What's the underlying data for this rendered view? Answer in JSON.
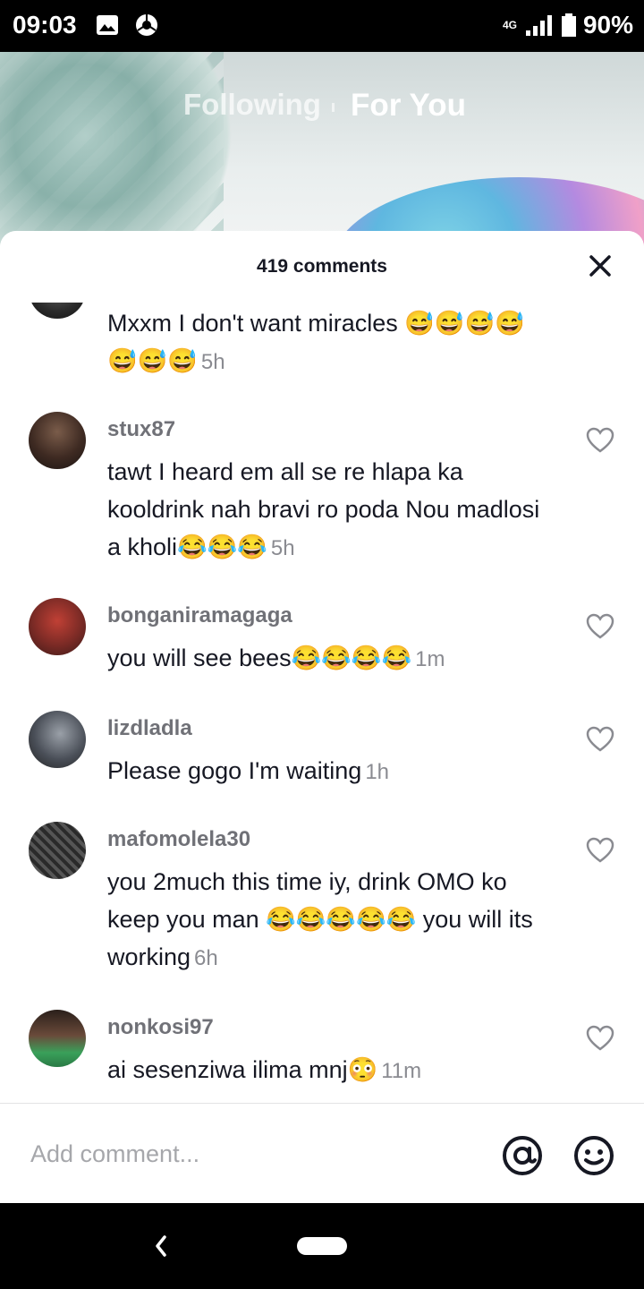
{
  "status_bar": {
    "time": "09:03",
    "network": "4G",
    "battery": "90%"
  },
  "feed_tabs": {
    "following": "Following",
    "for_you": "For You"
  },
  "sheet": {
    "title": "419 comments"
  },
  "comments": [
    {
      "username": "",
      "text": "Mxxm I don't want miracles 😅😅😅😅😅😅😅",
      "time": "5h"
    },
    {
      "username": "stux87",
      "text": "tawt I heard em all se re hlapa ka kooldrink nah bravi ro poda Nou madlosi a kholi😂😂😂",
      "time": "5h"
    },
    {
      "username": "bonganiramagaga",
      "text": "you will see bees😂😂😂😂",
      "time": "1m"
    },
    {
      "username": "lizdladla",
      "text": "Please gogo I'm waiting",
      "time": "1h"
    },
    {
      "username": "mafomolela30",
      "text": "you 2much this time iy, drink OMO ko keep you man 😂😂😂😂😂 you will its working",
      "time": "6h"
    },
    {
      "username": "nonkosi97",
      "text": "ai sesenziwa ilima mnj😳",
      "time": "11m"
    }
  ],
  "composer": {
    "placeholder": "Add comment..."
  },
  "colors": {
    "accent": "#161823",
    "muted": "#8a8b91",
    "background": "#ffffff"
  }
}
